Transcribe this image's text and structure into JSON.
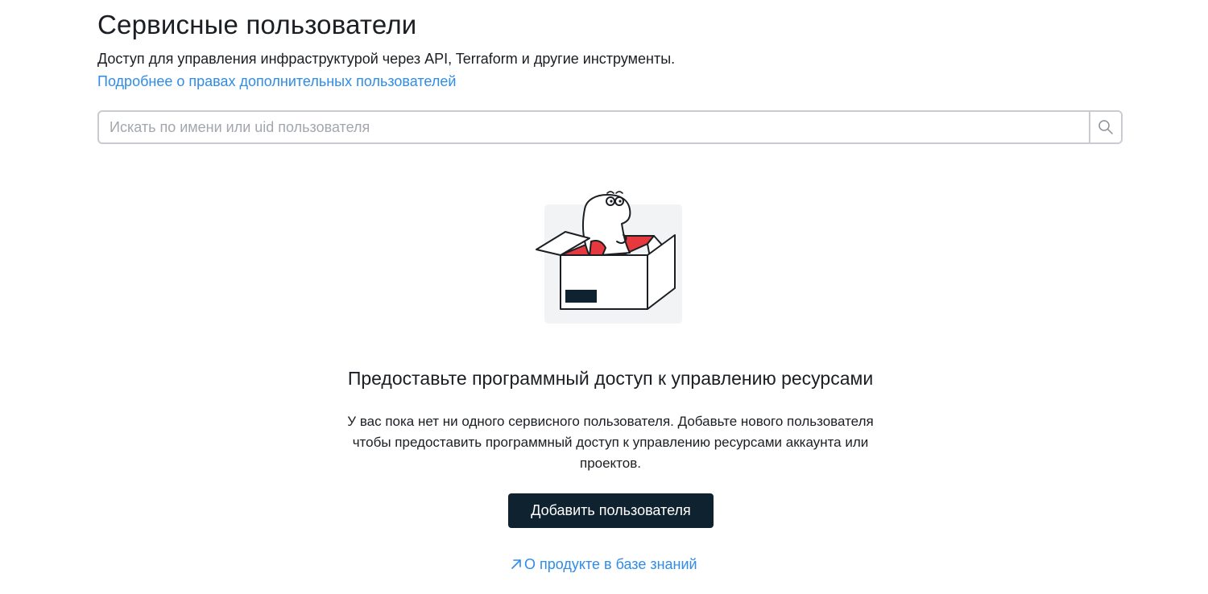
{
  "header": {
    "title": "Сервисные пользователи",
    "description": "Доступ для управления инфраструктурой через API, Terraform и другие инструменты.",
    "help_link": "Подробнее о правах дополнительных пользователей"
  },
  "search": {
    "placeholder": "Искать по имени или uid пользователя",
    "value": "",
    "icon": "search-icon"
  },
  "empty_state": {
    "illustration": "dino-in-box-illustration",
    "title": "Предоставьте программный доступ к управлению ресурсами",
    "text": "У вас пока нет ни одного сервисного пользователя. Добавьте нового пользователя чтобы предоставить программный доступ к управлению ресурсами аккаунта или проектов.",
    "add_button": "Добавить пользователя",
    "kb_link": "О продукте в базе знаний",
    "kb_link_icon": "arrow-up-right-icon"
  },
  "colors": {
    "link": "#2f8ce8",
    "button_bg": "#0f222f",
    "border": "#c8ccd0",
    "accent_red": "#e5393f"
  }
}
